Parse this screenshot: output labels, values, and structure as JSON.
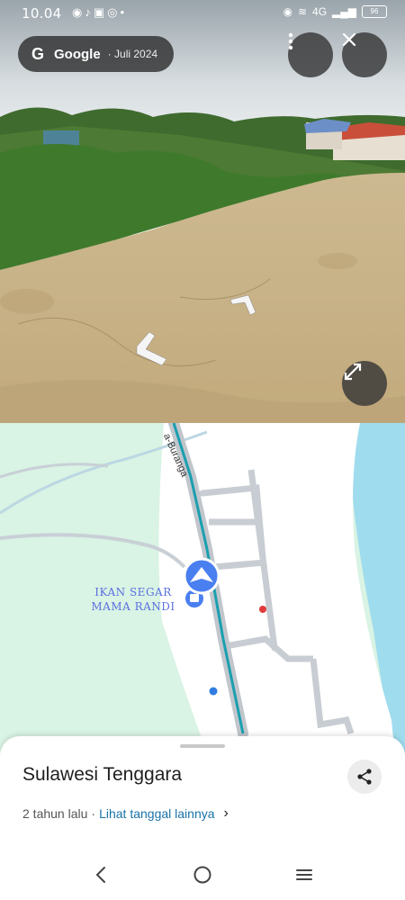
{
  "status_bar": {
    "time": "10.04",
    "battery": "96",
    "network": "4G"
  },
  "street_view": {
    "provider": "Google",
    "capture_date": "Juli 2024"
  },
  "map": {
    "road_label": "a-Buranga",
    "poi_line1": "IKAN SEGAR",
    "poi_line2": "MAMA RANDI"
  },
  "place": {
    "title": "Sulawesi Tenggara",
    "age": "2 tahun lalu",
    "separator": "·",
    "more_dates_link": "Lihat tanggal lainnya"
  },
  "icons": {
    "more": "more-vert-icon",
    "close": "close-icon",
    "expand": "expand-icon",
    "share": "share-icon",
    "back": "back-icon",
    "home": "home-icon",
    "recents": "recents-icon"
  },
  "colors": {
    "route": "#1a9fb0",
    "location_marker": "#4a7ff0",
    "water": "#9fdced",
    "land": "#d9f3e4",
    "link": "#1a73a8"
  }
}
